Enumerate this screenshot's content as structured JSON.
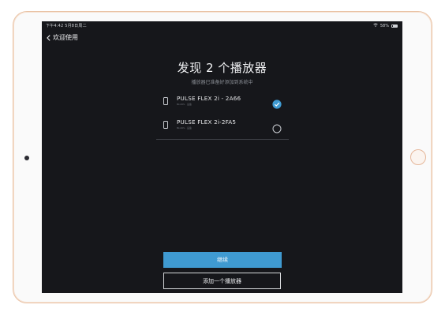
{
  "status_bar": {
    "left_text": "下午4:42  5月8日周二",
    "right_text": "58%"
  },
  "nav": {
    "back_label": "欢迎使用"
  },
  "header": {
    "title": "发现 2 个播放器",
    "subtitle": "播放器已准备好添加到系统中"
  },
  "players": [
    {
      "name": "PULSE FLEX 2i - 2A66",
      "sub": "BLUOS · 设备",
      "selected": true
    },
    {
      "name": "PULSE FLEX 2i-2FA5",
      "sub": "BLUOS · 设备",
      "selected": false
    }
  ],
  "buttons": {
    "primary_label": "继续",
    "secondary_label": "添加一个播放器"
  },
  "colors": {
    "accent": "#3f9ad1",
    "screen_bg": "#16171b",
    "frame": "#e9c2a4"
  }
}
